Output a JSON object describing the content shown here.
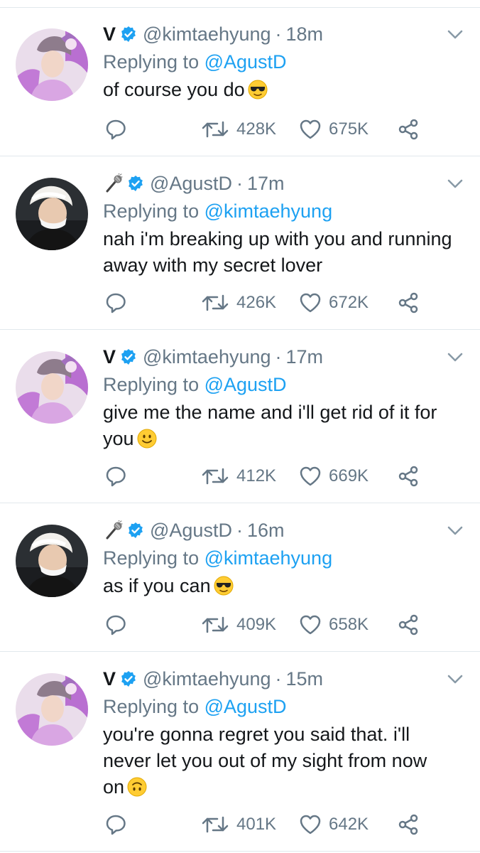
{
  "tweets": [
    {
      "account": "v",
      "display_name": "V",
      "handle": "@kimtaehyung",
      "time": "18m",
      "reply_prefix": "Replying to ",
      "reply_to": "@AgustD",
      "lines": [
        "of course you do"
      ],
      "emoji": "sunglasses-emoji",
      "retweets": "428K",
      "likes": "675K"
    },
    {
      "account": "agustd",
      "display_name": "",
      "handle": "@AgustD",
      "time": "17m",
      "reply_prefix": "Replying to ",
      "reply_to": "@kimtaehyung",
      "lines": [
        "nah i'm breaking up with you and running",
        "away with my secret lover"
      ],
      "emoji": "",
      "retweets": "426K",
      "likes": "672K"
    },
    {
      "account": "v",
      "display_name": "V",
      "handle": "@kimtaehyung",
      "time": "17m",
      "reply_prefix": "Replying to ",
      "reply_to": "@AgustD",
      "lines": [
        "give me the name and i'll get rid of it for",
        "you"
      ],
      "emoji": "smile-emoji",
      "retweets": "412K",
      "likes": "669K"
    },
    {
      "account": "agustd",
      "display_name": "",
      "handle": "@AgustD",
      "time": "16m",
      "reply_prefix": "Replying to ",
      "reply_to": "@kimtaehyung",
      "lines": [
        "as if you can"
      ],
      "emoji": "sunglasses-emoji",
      "retweets": "409K",
      "likes": "658K"
    },
    {
      "account": "v",
      "display_name": "V",
      "handle": "@kimtaehyung",
      "time": "15m",
      "reply_prefix": "Replying to ",
      "reply_to": "@AgustD",
      "lines": [
        "you're gonna regret you said that. i'll",
        "never let you out of my sight from now",
        "on"
      ],
      "emoji": "upside-down-emoji",
      "retweets": "401K",
      "likes": "642K"
    }
  ],
  "colors": {
    "link": "#1da1f2",
    "muted": "#657786",
    "text": "#14171a",
    "divider": "#e1e8ed",
    "verified": "#1da1f2"
  },
  "icons": {
    "verified": "verified-badge-icon",
    "mic": "microphone-icon",
    "caret": "chevron-down-icon",
    "reply": "reply-icon",
    "retweet": "retweet-icon",
    "like": "heart-icon",
    "share": "share-icon"
  }
}
